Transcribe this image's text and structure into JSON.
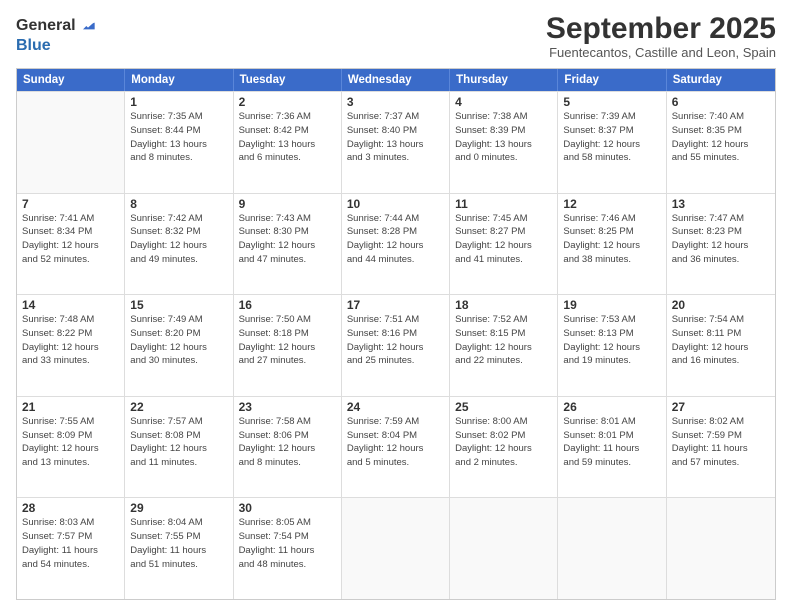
{
  "logo": {
    "general": "General",
    "blue": "Blue"
  },
  "title": "September 2025",
  "location": "Fuentecantos, Castille and Leon, Spain",
  "days_of_week": [
    "Sunday",
    "Monday",
    "Tuesday",
    "Wednesday",
    "Thursday",
    "Friday",
    "Saturday"
  ],
  "weeks": [
    [
      {
        "day": "",
        "lines": []
      },
      {
        "day": "1",
        "lines": [
          "Sunrise: 7:35 AM",
          "Sunset: 8:44 PM",
          "Daylight: 13 hours",
          "and 8 minutes."
        ]
      },
      {
        "day": "2",
        "lines": [
          "Sunrise: 7:36 AM",
          "Sunset: 8:42 PM",
          "Daylight: 13 hours",
          "and 6 minutes."
        ]
      },
      {
        "day": "3",
        "lines": [
          "Sunrise: 7:37 AM",
          "Sunset: 8:40 PM",
          "Daylight: 13 hours",
          "and 3 minutes."
        ]
      },
      {
        "day": "4",
        "lines": [
          "Sunrise: 7:38 AM",
          "Sunset: 8:39 PM",
          "Daylight: 13 hours",
          "and 0 minutes."
        ]
      },
      {
        "day": "5",
        "lines": [
          "Sunrise: 7:39 AM",
          "Sunset: 8:37 PM",
          "Daylight: 12 hours",
          "and 58 minutes."
        ]
      },
      {
        "day": "6",
        "lines": [
          "Sunrise: 7:40 AM",
          "Sunset: 8:35 PM",
          "Daylight: 12 hours",
          "and 55 minutes."
        ]
      }
    ],
    [
      {
        "day": "7",
        "lines": [
          "Sunrise: 7:41 AM",
          "Sunset: 8:34 PM",
          "Daylight: 12 hours",
          "and 52 minutes."
        ]
      },
      {
        "day": "8",
        "lines": [
          "Sunrise: 7:42 AM",
          "Sunset: 8:32 PM",
          "Daylight: 12 hours",
          "and 49 minutes."
        ]
      },
      {
        "day": "9",
        "lines": [
          "Sunrise: 7:43 AM",
          "Sunset: 8:30 PM",
          "Daylight: 12 hours",
          "and 47 minutes."
        ]
      },
      {
        "day": "10",
        "lines": [
          "Sunrise: 7:44 AM",
          "Sunset: 8:28 PM",
          "Daylight: 12 hours",
          "and 44 minutes."
        ]
      },
      {
        "day": "11",
        "lines": [
          "Sunrise: 7:45 AM",
          "Sunset: 8:27 PM",
          "Daylight: 12 hours",
          "and 41 minutes."
        ]
      },
      {
        "day": "12",
        "lines": [
          "Sunrise: 7:46 AM",
          "Sunset: 8:25 PM",
          "Daylight: 12 hours",
          "and 38 minutes."
        ]
      },
      {
        "day": "13",
        "lines": [
          "Sunrise: 7:47 AM",
          "Sunset: 8:23 PM",
          "Daylight: 12 hours",
          "and 36 minutes."
        ]
      }
    ],
    [
      {
        "day": "14",
        "lines": [
          "Sunrise: 7:48 AM",
          "Sunset: 8:22 PM",
          "Daylight: 12 hours",
          "and 33 minutes."
        ]
      },
      {
        "day": "15",
        "lines": [
          "Sunrise: 7:49 AM",
          "Sunset: 8:20 PM",
          "Daylight: 12 hours",
          "and 30 minutes."
        ]
      },
      {
        "day": "16",
        "lines": [
          "Sunrise: 7:50 AM",
          "Sunset: 8:18 PM",
          "Daylight: 12 hours",
          "and 27 minutes."
        ]
      },
      {
        "day": "17",
        "lines": [
          "Sunrise: 7:51 AM",
          "Sunset: 8:16 PM",
          "Daylight: 12 hours",
          "and 25 minutes."
        ]
      },
      {
        "day": "18",
        "lines": [
          "Sunrise: 7:52 AM",
          "Sunset: 8:15 PM",
          "Daylight: 12 hours",
          "and 22 minutes."
        ]
      },
      {
        "day": "19",
        "lines": [
          "Sunrise: 7:53 AM",
          "Sunset: 8:13 PM",
          "Daylight: 12 hours",
          "and 19 minutes."
        ]
      },
      {
        "day": "20",
        "lines": [
          "Sunrise: 7:54 AM",
          "Sunset: 8:11 PM",
          "Daylight: 12 hours",
          "and 16 minutes."
        ]
      }
    ],
    [
      {
        "day": "21",
        "lines": [
          "Sunrise: 7:55 AM",
          "Sunset: 8:09 PM",
          "Daylight: 12 hours",
          "and 13 minutes."
        ]
      },
      {
        "day": "22",
        "lines": [
          "Sunrise: 7:57 AM",
          "Sunset: 8:08 PM",
          "Daylight: 12 hours",
          "and 11 minutes."
        ]
      },
      {
        "day": "23",
        "lines": [
          "Sunrise: 7:58 AM",
          "Sunset: 8:06 PM",
          "Daylight: 12 hours",
          "and 8 minutes."
        ]
      },
      {
        "day": "24",
        "lines": [
          "Sunrise: 7:59 AM",
          "Sunset: 8:04 PM",
          "Daylight: 12 hours",
          "and 5 minutes."
        ]
      },
      {
        "day": "25",
        "lines": [
          "Sunrise: 8:00 AM",
          "Sunset: 8:02 PM",
          "Daylight: 12 hours",
          "and 2 minutes."
        ]
      },
      {
        "day": "26",
        "lines": [
          "Sunrise: 8:01 AM",
          "Sunset: 8:01 PM",
          "Daylight: 11 hours",
          "and 59 minutes."
        ]
      },
      {
        "day": "27",
        "lines": [
          "Sunrise: 8:02 AM",
          "Sunset: 7:59 PM",
          "Daylight: 11 hours",
          "and 57 minutes."
        ]
      }
    ],
    [
      {
        "day": "28",
        "lines": [
          "Sunrise: 8:03 AM",
          "Sunset: 7:57 PM",
          "Daylight: 11 hours",
          "and 54 minutes."
        ]
      },
      {
        "day": "29",
        "lines": [
          "Sunrise: 8:04 AM",
          "Sunset: 7:55 PM",
          "Daylight: 11 hours",
          "and 51 minutes."
        ]
      },
      {
        "day": "30",
        "lines": [
          "Sunrise: 8:05 AM",
          "Sunset: 7:54 PM",
          "Daylight: 11 hours",
          "and 48 minutes."
        ]
      },
      {
        "day": "",
        "lines": []
      },
      {
        "day": "",
        "lines": []
      },
      {
        "day": "",
        "lines": []
      },
      {
        "day": "",
        "lines": []
      }
    ]
  ]
}
